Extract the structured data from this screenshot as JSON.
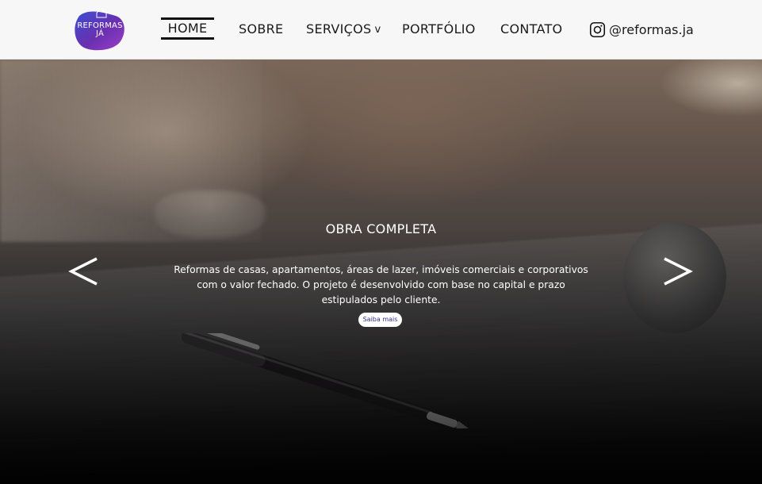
{
  "header": {
    "logo_text": "REFORMAS\nJÁ",
    "nav": {
      "home": "HOME",
      "sobre": "SOBRE",
      "servicos": "SERVIÇOS",
      "servicos_chevron": "v",
      "portfolio": "PORTFÓLIO",
      "contato": "CONTATO"
    },
    "instagram_handle": "@reformas.ja"
  },
  "hero": {
    "title": "OBRA COMPLETA",
    "description": "Reformas de casas, apartamentos, áreas de lazer, imóveis comerciais e corporativos com o valor fechado. O projeto é desenvolvido com base no capital e prazo estipulados pelo cliente.",
    "cta_label": "Saiba mais",
    "prev_icon": "chevron-left-icon",
    "next_icon": "chevron-right-icon"
  },
  "colors": {
    "logo_purple": "#6a2fb0",
    "logo_blue": "#3a4fd0",
    "cta_text": "#2b2a8a"
  }
}
